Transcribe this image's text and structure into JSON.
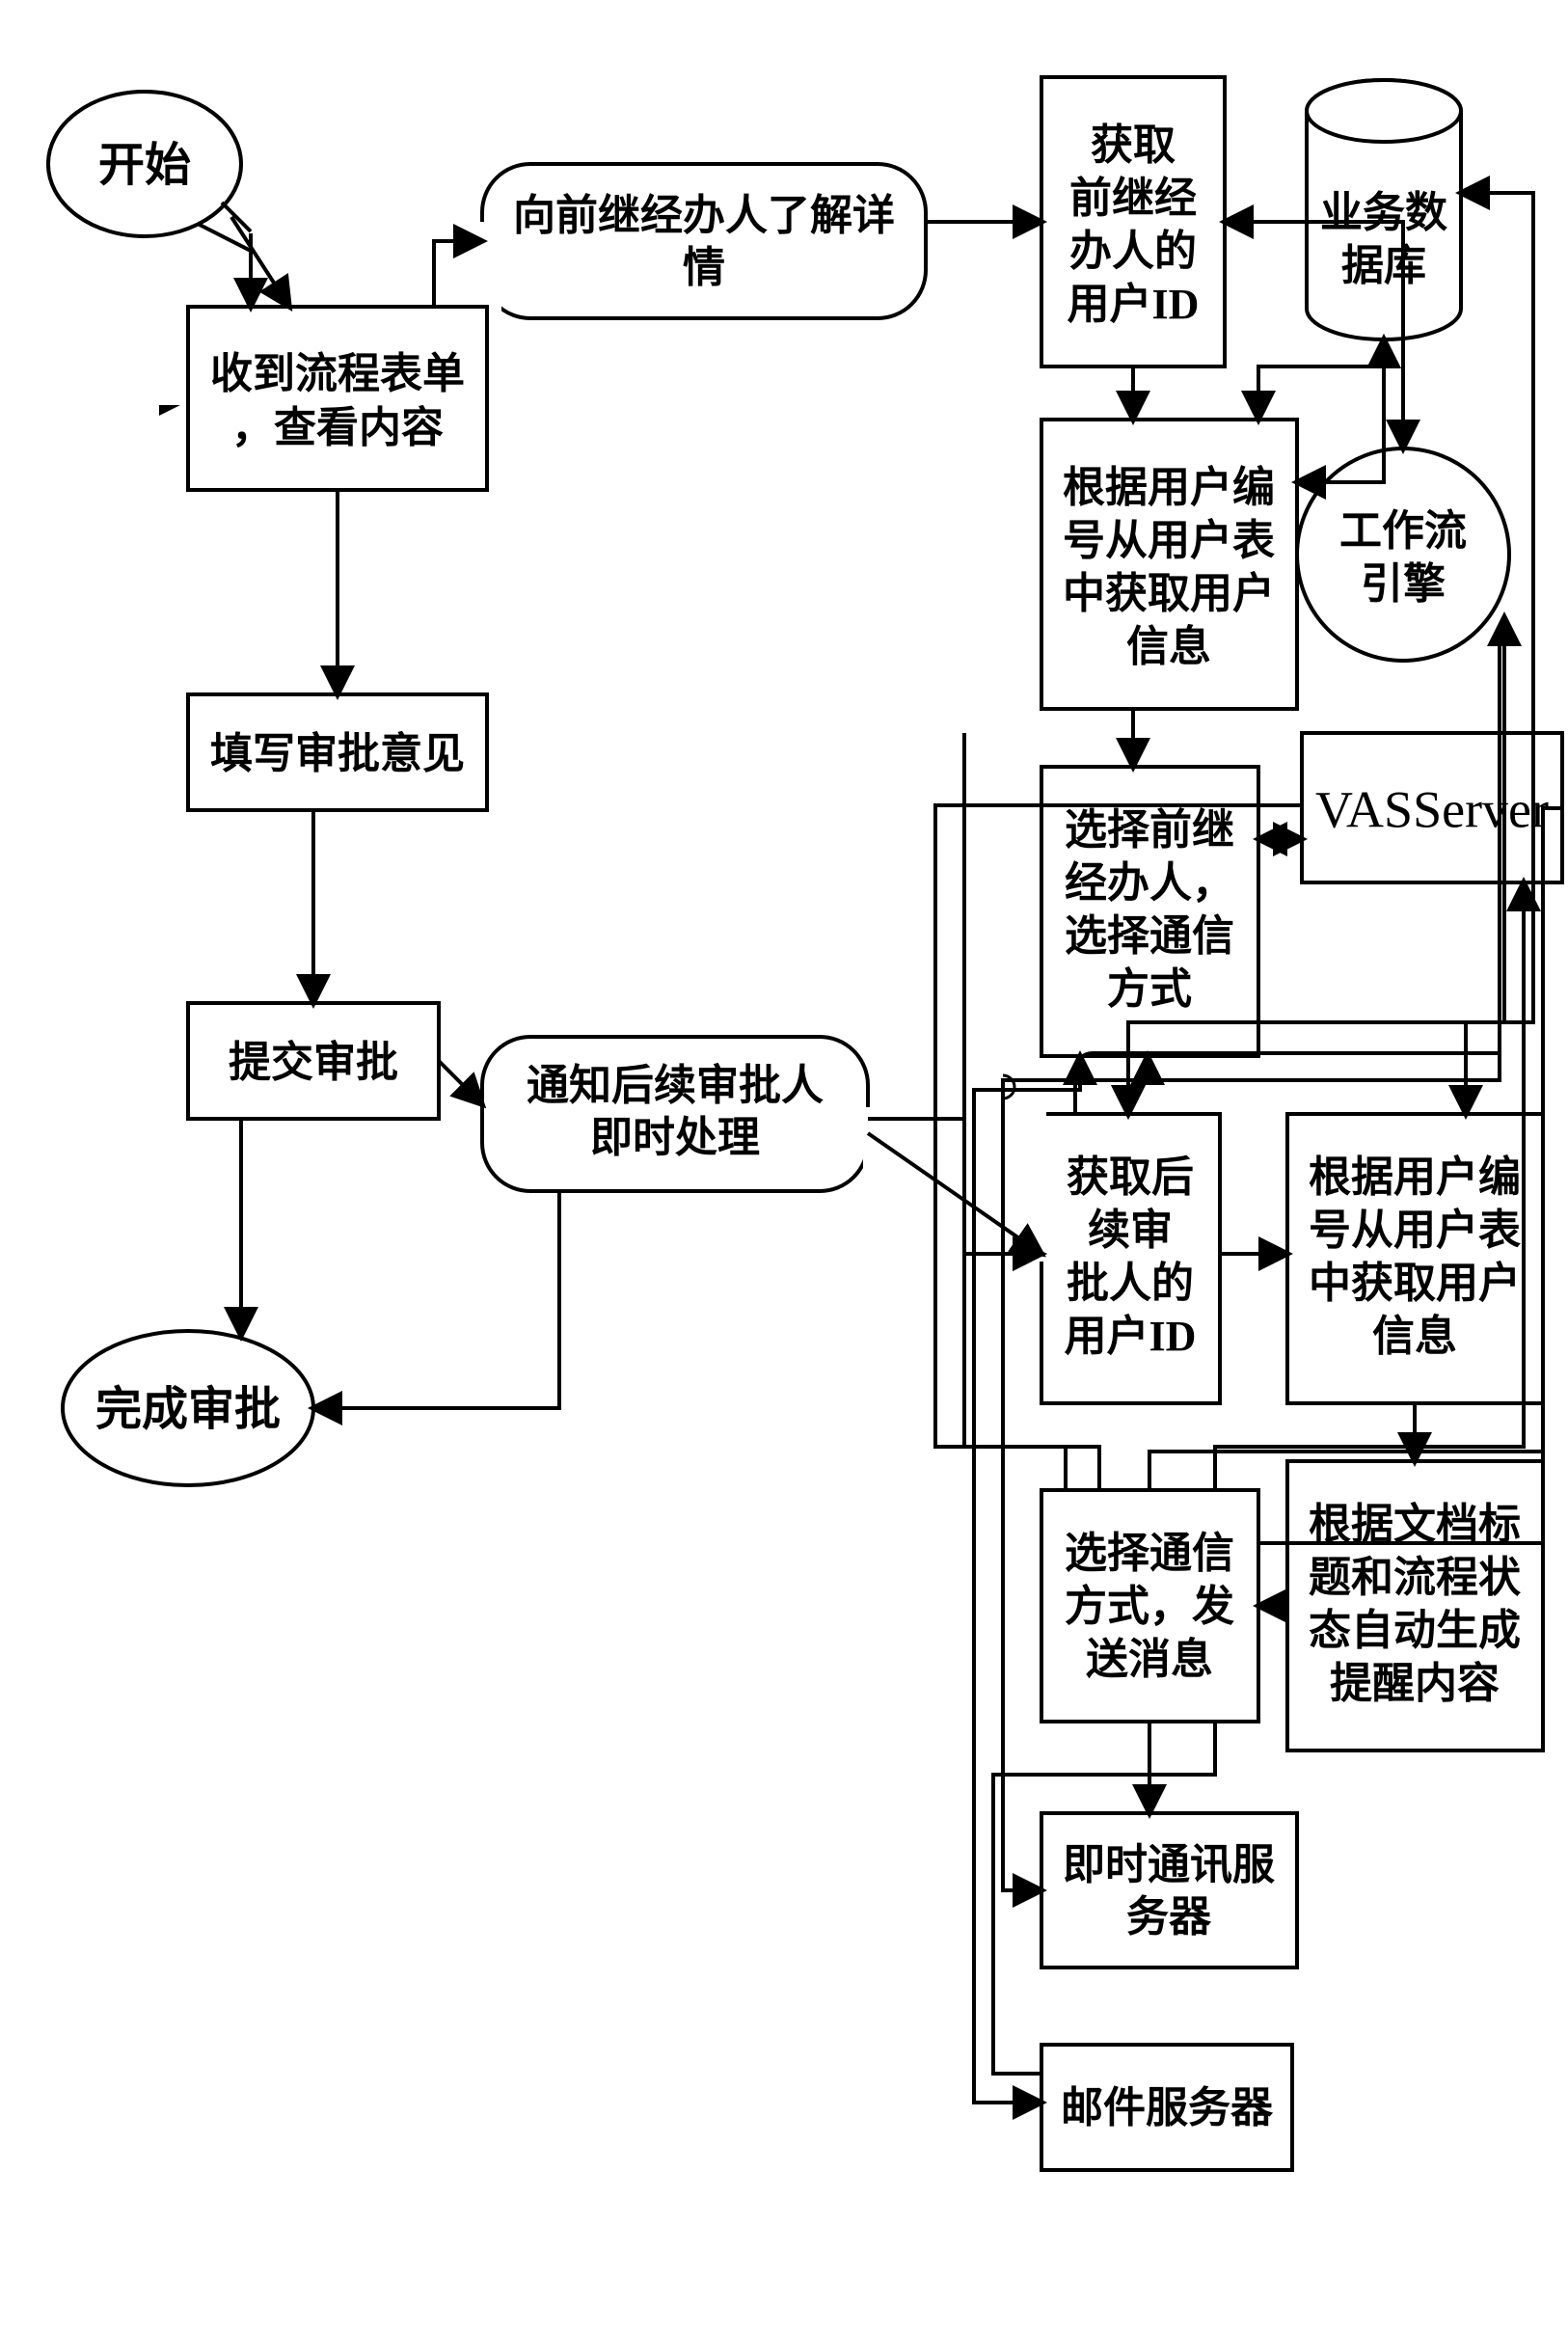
{
  "chart_data": {
    "type": "diagram",
    "title": "",
    "nodes": [
      {
        "id": "start",
        "shape": "ellipse",
        "label": "开始"
      },
      {
        "id": "receive",
        "shape": "rect",
        "label": "收到流程表单，查看内容"
      },
      {
        "id": "opinion",
        "shape": "rect",
        "label": "填写审批意见"
      },
      {
        "id": "submit",
        "shape": "rect",
        "label": "提交审批"
      },
      {
        "id": "done",
        "shape": "ellipse",
        "label": "完成审批"
      },
      {
        "id": "askPrev",
        "shape": "round-rect",
        "label": "向前继经办人了解详情"
      },
      {
        "id": "notifyNext",
        "shape": "round-rect",
        "label": "通知后续审批人即时处理"
      },
      {
        "id": "getPrevId",
        "shape": "rect",
        "label": "获取前继经办人的用户ID"
      },
      {
        "id": "getPrevInfo",
        "shape": "rect",
        "label": "根据用户编号从用户表中获取用户信息"
      },
      {
        "id": "selPrev",
        "shape": "rect",
        "label": "选择前继经办人，选择通信方式"
      },
      {
        "id": "getNextId",
        "shape": "rect",
        "label": "获取后续审批人的用户ID"
      },
      {
        "id": "getNextInfo",
        "shape": "rect",
        "label": "根据用户编号从用户表中获取用户信息"
      },
      {
        "id": "genContent",
        "shape": "rect",
        "label": "根据文档标题和流程状态自动生成提醒内容"
      },
      {
        "id": "selSend",
        "shape": "rect",
        "label": "选择通信方式，发送消息"
      },
      {
        "id": "db",
        "shape": "cylinder",
        "label": "业务数据库"
      },
      {
        "id": "wf",
        "shape": "circle",
        "label": "工作流引擎"
      },
      {
        "id": "vas",
        "shape": "rect",
        "label": "VASServer"
      },
      {
        "id": "im",
        "shape": "rect",
        "label": "即时通讯服务器"
      },
      {
        "id": "mail",
        "shape": "rect",
        "label": "邮件服务器"
      }
    ],
    "edges": [
      [
        "start",
        "receive"
      ],
      [
        "receive",
        "opinion"
      ],
      [
        "opinion",
        "submit"
      ],
      [
        "submit",
        "done"
      ],
      [
        "receive",
        "askPrev"
      ],
      [
        "submit",
        "notifyNext"
      ],
      [
        "askPrev",
        "getPrevId"
      ],
      [
        "getPrevId",
        "getPrevInfo"
      ],
      [
        "getPrevInfo",
        "selPrev"
      ],
      [
        "notifyNext",
        "getNextId"
      ],
      [
        "getNextId",
        "getNextInfo"
      ],
      [
        "getNextInfo",
        "genContent"
      ],
      [
        "genContent",
        "selSend"
      ],
      [
        "notifyNext",
        "done"
      ],
      [
        "getPrevId",
        "wf",
        "bi"
      ],
      [
        "getNextId",
        "wf",
        "bi"
      ],
      [
        "getPrevInfo",
        "db",
        "bi"
      ],
      [
        "getNextInfo",
        "db",
        "bi"
      ],
      [
        "selPrev",
        "vas",
        "bi"
      ],
      [
        "selPrev",
        "im",
        "bi"
      ],
      [
        "selPrev",
        "mail",
        "bi"
      ],
      [
        "selSend",
        "vas"
      ],
      [
        "selSend",
        "im"
      ],
      [
        "selSend",
        "mail"
      ]
    ]
  },
  "labels": {
    "start": "开始",
    "receive_l1": "收到流程表单",
    "receive_l2": "，查看内容",
    "opinion": "填写审批意见",
    "submit": "提交审批",
    "done": "完成审批",
    "askPrev_l1": "向前继经办人了解详",
    "askPrev_l2": "情",
    "notifyNext_l1": "通知后续审批人",
    "notifyNext_l2": "即时处理",
    "getPrevId_l1": "获取",
    "getPrevId_l2": "前继经",
    "getPrevId_l3": "办人的",
    "getPrevId_l4": "用户ID",
    "getPrevInfo_l1": "根据用户编",
    "getPrevInfo_l2": "号从用户表",
    "getPrevInfo_l3": "中获取用户",
    "getPrevInfo_l4": "信息",
    "selPrev_l1": "选择前继",
    "selPrev_l2": "经办人，",
    "selPrev_l3": "选择通信",
    "selPrev_l4": "方式",
    "getNextId_l1": "获取后",
    "getNextId_l2": "续审",
    "getNextId_l3": "批人的",
    "getNextId_l4": "用户ID",
    "getNextInfo_l1": "根据用户编",
    "getNextInfo_l2": "号从用户表",
    "getNextInfo_l3": "中获取用户",
    "getNextInfo_l4": "信息",
    "genContent_l1": "根据文档标",
    "genContent_l2": "题和流程状",
    "genContent_l3": "态自动生成",
    "genContent_l4": "提醒内容",
    "selSend_l1": "选择通信",
    "selSend_l2": "方式，发",
    "selSend_l3": "送消息",
    "db_l1": "业务数",
    "db_l2": "据库",
    "wf_l1": "工作流",
    "wf_l2": "引擎",
    "vas": "VASServer",
    "im_l1": "即时通讯服",
    "im_l2": "务器",
    "mail": "邮件服务器"
  }
}
